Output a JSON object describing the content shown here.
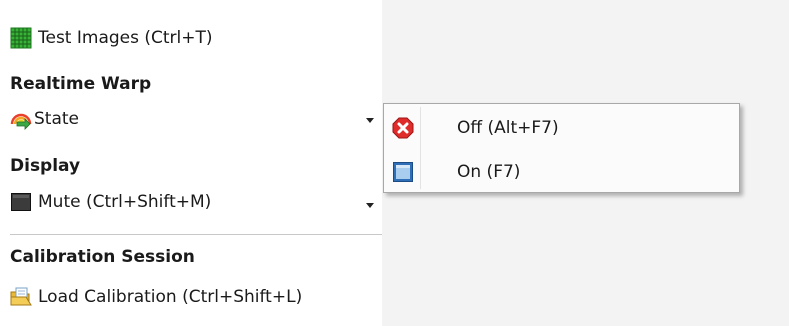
{
  "panel": {
    "test_images": {
      "label": "Test Images (Ctrl+T)",
      "icon": "grid-icon"
    },
    "realtime_warp_header": "Realtime Warp",
    "state": {
      "label": "State",
      "icon": "rainbow-arrow-icon"
    },
    "display_header": "Display",
    "mute": {
      "label": "Mute (Ctrl+Shift+M)",
      "icon": "black-square-icon"
    },
    "calibration_header": "Calibration Session",
    "load_calibration": {
      "label": "Load Calibration (Ctrl+Shift+L)",
      "icon": "folder-open-icon"
    }
  },
  "state_menu": {
    "items": [
      {
        "label": "Off (Alt+F7)",
        "icon": "red-x-icon"
      },
      {
        "label": "On (F7)",
        "icon": "blue-square-icon"
      }
    ]
  },
  "colors": {
    "grid_green": "#2e9e2e",
    "off_red": "#e02b2b",
    "on_blue": "#2f6fb7"
  }
}
